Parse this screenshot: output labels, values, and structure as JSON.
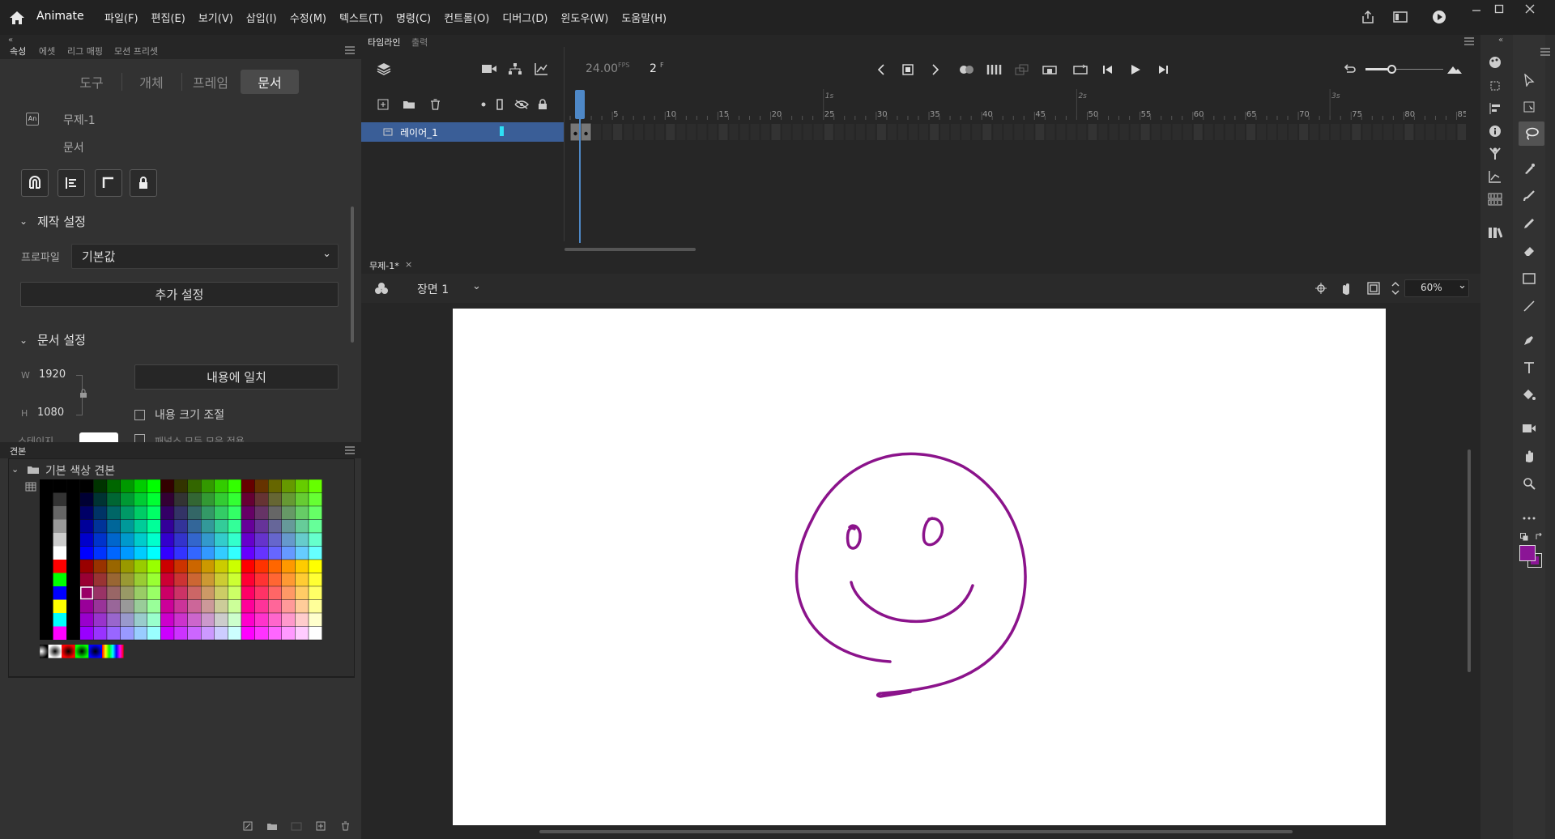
{
  "app": {
    "name": "Animate"
  },
  "menu": [
    "파일(F)",
    "편집(E)",
    "보기(V)",
    "삽입(I)",
    "수정(M)",
    "텍스트(T)",
    "명령(C)",
    "컨트롤(O)",
    "디버그(D)",
    "윈도우(W)",
    "도움말(H)"
  ],
  "left_tabs": [
    "속성",
    "에셋",
    "리그 매핑",
    "모션 프리셋"
  ],
  "prop_segments": [
    "도구",
    "개체",
    "프레임",
    "문서"
  ],
  "doc": {
    "name": "무제-1",
    "type_label": "문서",
    "icon_text": "An"
  },
  "publish": {
    "title": "제작 설정",
    "profile_label": "프로파일",
    "profile_value": "기본값",
    "more_button": "추가 설정"
  },
  "doc_settings": {
    "title": "문서 설정",
    "w_label": "W",
    "w_value": "1920",
    "h_label": "H",
    "h_value": "1080",
    "fit_button": "내용에 일치",
    "scale_label": "내용 크기 조절",
    "stage_label": "스테이지",
    "partial_label": "패널스 모든 모음 적용"
  },
  "swatches": {
    "tab": "견본",
    "folder": "기본 색상 견본"
  },
  "timeline": {
    "tab": "타임라인",
    "output_tab": "출력",
    "fps": "24.00",
    "fps_unit": "FPS",
    "frame": "2",
    "frame_unit": "F",
    "ticks": [
      "5",
      "10",
      "15",
      "20",
      "25",
      "30",
      "35",
      "40",
      "45",
      "50",
      "55",
      "60",
      "65",
      "70",
      "75",
      "80",
      "85"
    ],
    "seconds": [
      "1s",
      "2s",
      "3s"
    ],
    "layer": "레이어_1"
  },
  "stage": {
    "doc_tab": "무제-1*",
    "scene": "장면 1",
    "zoom": "60%"
  },
  "colors": {
    "stroke": "#8b138b",
    "fill": "#8b1596",
    "selection": "#3a5e97"
  }
}
